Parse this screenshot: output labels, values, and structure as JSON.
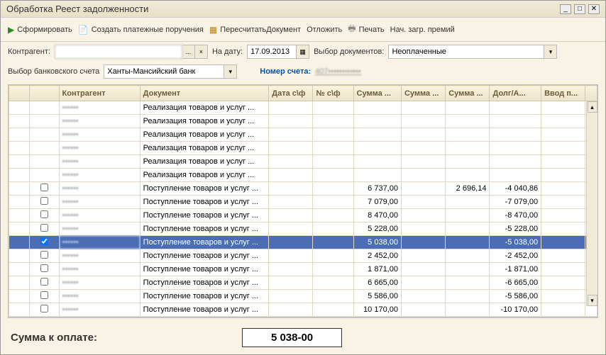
{
  "window": {
    "title": "Обработка  Реест задолженности"
  },
  "toolbar": {
    "form": "Сформировать",
    "create": "Создать платежные поручения",
    "recalc": "ПересчитатьДокумент",
    "postpone": "Отложить",
    "print": "Печать",
    "premiums": "Нач. загр. премий"
  },
  "filters": {
    "contractor_label": "Контрагент:",
    "contractor_value": "",
    "date_label": "На дату:",
    "date_value": "17.09.2013",
    "doc_sel_label": "Выбор документов:",
    "doc_sel_value": "Неоплаченные",
    "bank_label": "Выбор банковского счета",
    "bank_value": "Ханты-Мансийский банк",
    "acct_label": "Номер счета:",
    "acct_value": "407••••••••••••"
  },
  "columns": {
    "c0": "",
    "c1": "",
    "c2": "Контрагент",
    "c3": "Документ",
    "c4": "Дата с\\ф",
    "c5": "№ с\\ф",
    "c6": "Сумма ...",
    "c7": "Сумма ...",
    "c8": "Сумма ...",
    "c9": "Долг/А...",
    "c10": "Ввод п..."
  },
  "rows": [
    {
      "chk": false,
      "contr": "••••••",
      "doc": "Реализация товаров и услуг ...",
      "sum1": "",
      "sum3": "",
      "debt": ""
    },
    {
      "chk": false,
      "contr": "••••••",
      "doc": "Реализация товаров и услуг ...",
      "sum1": "",
      "sum3": "",
      "debt": ""
    },
    {
      "chk": false,
      "contr": "••••••",
      "doc": "Реализация товаров и услуг ...",
      "sum1": "",
      "sum3": "",
      "debt": ""
    },
    {
      "chk": false,
      "contr": "••••••",
      "doc": "Реализация товаров и услуг ...",
      "sum1": "",
      "sum3": "",
      "debt": ""
    },
    {
      "chk": false,
      "contr": "••••••",
      "doc": "Реализация товаров и услуг ...",
      "sum1": "",
      "sum3": "",
      "debt": ""
    },
    {
      "chk": false,
      "contr": "••••••",
      "doc": "Реализация товаров и услуг ...",
      "sum1": "",
      "sum3": "",
      "debt": ""
    },
    {
      "chk": false,
      "contr": "••••••",
      "doc": "Поступление товаров и услуг ...",
      "sum1": "6 737,00",
      "sum3": "2 696,14",
      "debt": "-4 040,86"
    },
    {
      "chk": false,
      "contr": "••••••",
      "doc": "Поступление товаров и услуг ...",
      "sum1": "7 079,00",
      "sum3": "",
      "debt": "-7 079,00"
    },
    {
      "chk": false,
      "contr": "••••••",
      "doc": "Поступление товаров и услуг ...",
      "sum1": "8 470,00",
      "sum3": "",
      "debt": "-8 470,00"
    },
    {
      "chk": false,
      "contr": "••••••",
      "doc": "Поступление товаров и услуг ...",
      "sum1": "5 228,00",
      "sum3": "",
      "debt": "-5 228,00"
    },
    {
      "chk": true,
      "contr": "••••••",
      "doc": "Поступление товаров и услуг ...",
      "sum1": "5 038,00",
      "sum3": "",
      "debt": "-5 038,00",
      "selected": true
    },
    {
      "chk": false,
      "contr": "••••••",
      "doc": "Поступление товаров и услуг ...",
      "sum1": "2 452,00",
      "sum3": "",
      "debt": "-2 452,00"
    },
    {
      "chk": false,
      "contr": "••••••",
      "doc": "Поступление товаров и услуг ...",
      "sum1": "1 871,00",
      "sum3": "",
      "debt": "-1 871,00"
    },
    {
      "chk": false,
      "contr": "••••••",
      "doc": "Поступление товаров и услуг ...",
      "sum1": "6 665,00",
      "sum3": "",
      "debt": "-6 665,00"
    },
    {
      "chk": false,
      "contr": "••••••",
      "doc": "Поступление товаров и услуг ...",
      "sum1": "5 586,00",
      "sum3": "",
      "debt": "-5 586,00"
    },
    {
      "chk": false,
      "contr": "••••••",
      "doc": "Поступление товаров и услуг ...",
      "sum1": "10 170,00",
      "sum3": "",
      "debt": "-10 170,00"
    }
  ],
  "footer": {
    "label": "Сумма к оплате:",
    "value": "5 038-00"
  }
}
